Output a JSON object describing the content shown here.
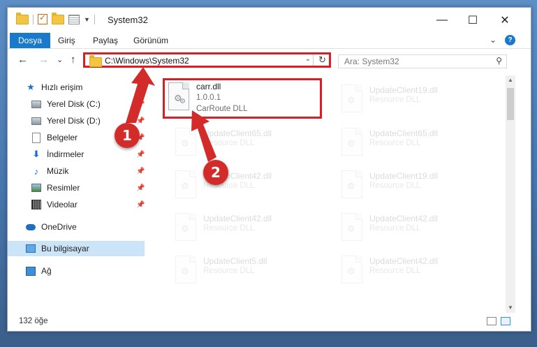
{
  "window": {
    "title": "System32",
    "minimize_glyph": "—",
    "maximize_glyph": "☐",
    "close_glyph": "✕"
  },
  "ribbon": {
    "tabs": [
      {
        "label": "Dosya",
        "active": true
      },
      {
        "label": "Giriş",
        "active": false
      },
      {
        "label": "Paylaş",
        "active": false
      },
      {
        "label": "Görünüm",
        "active": false
      }
    ],
    "expand_glyph": "⌄",
    "help_glyph": "?"
  },
  "navigation": {
    "back_glyph": "←",
    "forward_glyph": "→",
    "recent_glyph": "⌄",
    "up_glyph": "↑",
    "address": "C:\\Windows\\System32",
    "address_dropdown_glyph": "⌄",
    "refresh_glyph": "↻",
    "search_placeholder": "Ara: System32",
    "search_glyph": "⚲"
  },
  "sidebar": {
    "items": [
      {
        "label": "Hızlı erişim",
        "icon": "star-icon",
        "pinned": false
      },
      {
        "label": "Yerel Disk (C:)",
        "icon": "drive-icon",
        "pinned": true
      },
      {
        "label": "Yerel Disk (D:)",
        "icon": "drive-icon",
        "pinned": true
      },
      {
        "label": "Belgeler",
        "icon": "documents-icon",
        "pinned": true
      },
      {
        "label": "İndirmeler",
        "icon": "download-icon",
        "pinned": true
      },
      {
        "label": "Müzik",
        "icon": "music-icon",
        "pinned": true
      },
      {
        "label": "Resimler",
        "icon": "pictures-icon",
        "pinned": true
      },
      {
        "label": "Videolar",
        "icon": "videos-icon",
        "pinned": true
      },
      {
        "label": "OneDrive",
        "icon": "onedrive-icon",
        "pinned": false
      },
      {
        "label": "Bu bilgisayar",
        "icon": "this-pc-icon",
        "pinned": false,
        "selected": true
      },
      {
        "label": "Ağ",
        "icon": "network-icon",
        "pinned": false
      }
    ],
    "pin_glyph": "📌"
  },
  "files": {
    "highlighted": {
      "name": "carr.dll",
      "version": "1.0.0.1",
      "description": "CarRoute DLL"
    },
    "left_column": [
      {
        "name": "UpdateClient65.dll",
        "description": "Resource DLL"
      },
      {
        "name": "UpdateClient42.dll",
        "description": "Resource DLL"
      },
      {
        "name": "UpdateClient42.dll",
        "description": "Resource DLL"
      },
      {
        "name": "UpdateClient5.dll",
        "description": "Resource DLL"
      }
    ],
    "right_column": [
      {
        "name": "UpdateClient19.dll",
        "description": "Resource DLL"
      },
      {
        "name": "UpdateClient65.dll",
        "description": "Resource DLL"
      },
      {
        "name": "UpdateClient19.dll",
        "description": "Resource DLL"
      },
      {
        "name": "UpdateClient42.dll",
        "description": "Resource DLL"
      },
      {
        "name": "UpdateClient42.dll",
        "description": "Resource DLL"
      }
    ]
  },
  "status": {
    "item_count": "132 öğe"
  },
  "callouts": {
    "one": "1",
    "two": "2",
    "color": "#d32a2a"
  }
}
